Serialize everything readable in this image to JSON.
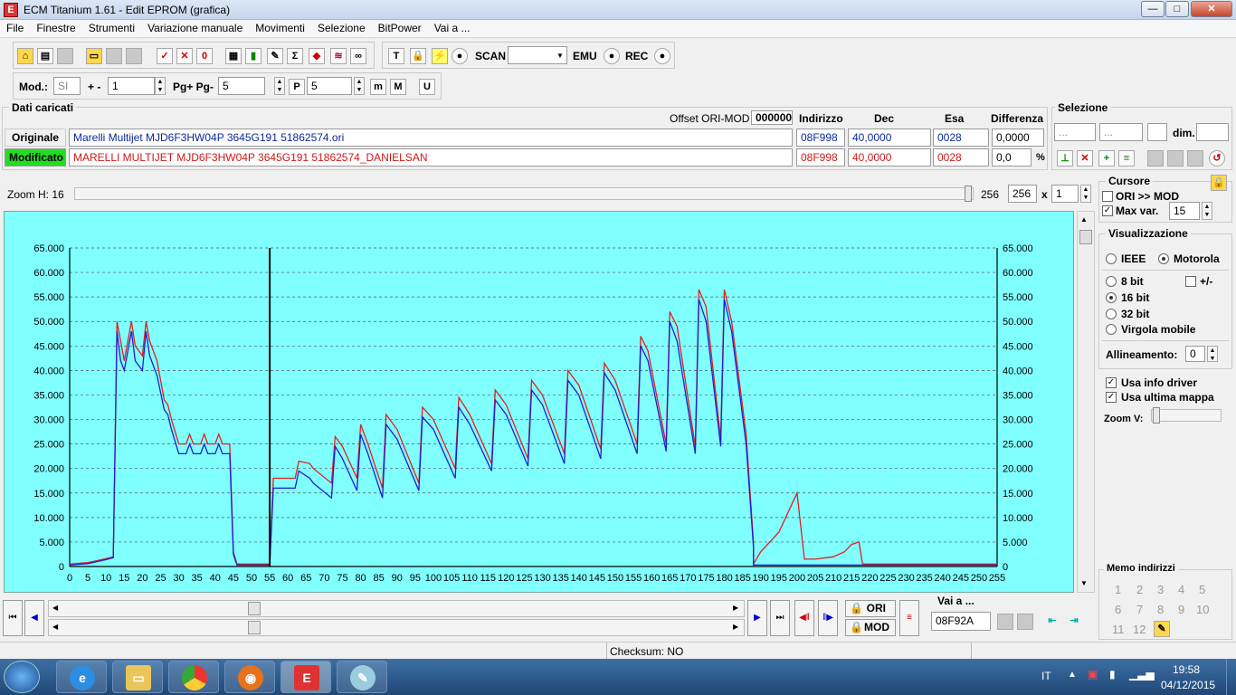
{
  "window": {
    "title": "ECM Titanium 1.61 - Edit EPROM (grafica)",
    "icon": "ecm-app-icon",
    "min": "—",
    "max": "□",
    "close": "✕"
  },
  "menu": [
    "File",
    "Finestre",
    "Strumenti",
    "Variazione manuale",
    "Movimenti",
    "Selezione",
    "BitPower",
    "Vai a ..."
  ],
  "toolbar1": {
    "scan": "SCAN",
    "emu": "EMU",
    "rec": "REC",
    "dropdown": ""
  },
  "toolbar2": {
    "mod_label": "Mod.:",
    "mod_value": "SI",
    "plusminus": "+ -",
    "step": "1",
    "pg_label": "Pg+ Pg-",
    "pg_value": "5",
    "p_value": "5"
  },
  "dati": {
    "title": "Dati caricati",
    "offset_label": "Offset ORI-MOD",
    "offset_value": "000000",
    "col_indirizzo": "Indirizzo",
    "col_dec": "Dec",
    "col_esa": "Esa",
    "col_diff": "Differenza",
    "originale": {
      "label": "Originale",
      "file": "Marelli Multijet MJD6F3HW04P 3645G191 51862574.ori",
      "addr": "08F998",
      "dec": "40,0000",
      "esa": "0028",
      "diff": "0,0000"
    },
    "modificato": {
      "label": "Modificato",
      "file": "MARELLI MULTIJET MJD6F3HW04P 3645G191 51862574_DANIELSAN",
      "addr": "08F998",
      "dec": "40,0000",
      "esa": "0028",
      "diff": "0,0",
      "pct": "%"
    }
  },
  "selezione": {
    "title": "Selezione",
    "f1": "...",
    "f2": "...",
    "dim_label": "dim.",
    "dim_value": ""
  },
  "zoom": {
    "label": "Zoom H: 16",
    "value1": "256",
    "value2": "256",
    "x": "x",
    "mult": "1"
  },
  "cursore": {
    "title": "Cursore",
    "ori_mod": "ORI >> MOD",
    "maxvar_label": "Max var.",
    "maxvar": "15"
  },
  "visual": {
    "title": "Visualizzazione",
    "ieee": "IEEE",
    "motorola": "Motorola",
    "bit8": "8 bit",
    "pm": "+/-",
    "bit16": "16 bit",
    "bit32": "32 bit",
    "virgola": "Virgola mobile",
    "allineamento": "Allineamento:",
    "allin_value": "0",
    "usa_info": "Usa info driver",
    "usa_ultima": "Usa ultima mappa",
    "zoomv": "Zoom V:"
  },
  "memo": {
    "title": "Memo indirizzi",
    "nums": [
      "1",
      "2",
      "3",
      "4",
      "5",
      "6",
      "7",
      "8",
      "9",
      "10",
      "11",
      "12"
    ]
  },
  "nav": {
    "ori": "ORI",
    "mod": "MOD",
    "vai_label": "Vai a ...",
    "vai_value": "08F92A"
  },
  "status": {
    "checksum": "Checksum: NO"
  },
  "tray": {
    "lang": "IT",
    "time": "19:58",
    "date": "04/12/2015"
  },
  "colors": {
    "chart_bg": "#80ffff",
    "ori_line": "#1f1fd0",
    "mod_line": "#e02020",
    "modificato_bg": "#22dd22"
  },
  "chart_data": {
    "type": "line",
    "xlim": [
      0,
      255
    ],
    "ylim": [
      0,
      65000
    ],
    "xticks": [
      "0",
      "5",
      "10",
      "15",
      "20",
      "25",
      "30",
      "35",
      "40",
      "45",
      "50",
      "55",
      "60",
      "65",
      "70",
      "75",
      "80",
      "85",
      "90",
      "95",
      "100",
      "105",
      "110",
      "115",
      "120",
      "125",
      "130",
      "135",
      "140",
      "145",
      "150",
      "155",
      "160",
      "165",
      "170",
      "175",
      "180",
      "185",
      "190",
      "195",
      "200",
      "205",
      "210",
      "215",
      "220",
      "225",
      "230",
      "235",
      "240",
      "245",
      "250",
      "255"
    ],
    "yticks": [
      "0",
      "5.000",
      "10.000",
      "15.000",
      "20.000",
      "25.000",
      "30.000",
      "35.000",
      "40.000",
      "45.000",
      "50.000",
      "55.000",
      "60.000",
      "65.000"
    ],
    "cursor_x": 55,
    "series": [
      {
        "color": "#e02020",
        "points": [
          [
            0,
            500
          ],
          [
            5,
            800
          ],
          [
            10,
            1600
          ],
          [
            12,
            2000
          ],
          [
            13,
            50000
          ],
          [
            14,
            46000
          ],
          [
            15,
            42000
          ],
          [
            17,
            50000
          ],
          [
            18,
            45000
          ],
          [
            20,
            43000
          ],
          [
            21,
            50000
          ],
          [
            22,
            46000
          ],
          [
            24,
            42000
          ],
          [
            26,
            34000
          ],
          [
            27,
            33000
          ],
          [
            28,
            30000
          ],
          [
            30,
            25000
          ],
          [
            32,
            25000
          ],
          [
            33,
            27000
          ],
          [
            34,
            25000
          ],
          [
            36,
            25000
          ],
          [
            37,
            27000
          ],
          [
            38,
            25000
          ],
          [
            40,
            25000
          ],
          [
            41,
            27000
          ],
          [
            42,
            25000
          ],
          [
            44,
            25000
          ],
          [
            45,
            3000
          ],
          [
            46,
            500
          ],
          [
            55,
            500
          ],
          [
            56,
            18000
          ],
          [
            62,
            18000
          ],
          [
            63,
            21500
          ],
          [
            66,
            21000
          ],
          [
            67,
            20000
          ],
          [
            72,
            17000
          ],
          [
            73,
            26500
          ],
          [
            75,
            24500
          ],
          [
            79,
            18000
          ],
          [
            80,
            29000
          ],
          [
            82,
            25000
          ],
          [
            86,
            16000
          ],
          [
            87,
            31000
          ],
          [
            90,
            28000
          ],
          [
            96,
            17000
          ],
          [
            97,
            32500
          ],
          [
            100,
            30000
          ],
          [
            106,
            20000
          ],
          [
            107,
            34500
          ],
          [
            110,
            31000
          ],
          [
            116,
            21000
          ],
          [
            117,
            36000
          ],
          [
            120,
            33000
          ],
          [
            126,
            22000
          ],
          [
            127,
            38000
          ],
          [
            130,
            35000
          ],
          [
            136,
            23000
          ],
          [
            137,
            40000
          ],
          [
            140,
            37000
          ],
          [
            146,
            24000
          ],
          [
            147,
            41500
          ],
          [
            150,
            38000
          ],
          [
            156,
            25000
          ],
          [
            157,
            47000
          ],
          [
            159,
            44000
          ],
          [
            164,
            25000
          ],
          [
            165,
            52000
          ],
          [
            167,
            49000
          ],
          [
            172,
            24500
          ],
          [
            173,
            56500
          ],
          [
            175,
            53000
          ],
          [
            179,
            26000
          ],
          [
            180,
            56500
          ],
          [
            182,
            50000
          ],
          [
            186,
            27000
          ],
          [
            188,
            5000
          ],
          [
            188,
            500
          ],
          [
            190,
            3000
          ],
          [
            195,
            7000
          ],
          [
            200,
            15000
          ],
          [
            202,
            1500
          ],
          [
            205,
            1500
          ],
          [
            210,
            2000
          ],
          [
            213,
            3000
          ],
          [
            215,
            4500
          ],
          [
            217,
            5000
          ],
          [
            218,
            500
          ],
          [
            255,
            500
          ]
        ]
      },
      {
        "color": "#1f1fd0",
        "points": [
          [
            0,
            300
          ],
          [
            5,
            600
          ],
          [
            10,
            1400
          ],
          [
            12,
            1800
          ],
          [
            13,
            48000
          ],
          [
            14,
            42000
          ],
          [
            15,
            40000
          ],
          [
            17,
            48000
          ],
          [
            18,
            42000
          ],
          [
            20,
            40000
          ],
          [
            21,
            48000
          ],
          [
            22,
            43000
          ],
          [
            24,
            39000
          ],
          [
            26,
            32000
          ],
          [
            27,
            31000
          ],
          [
            28,
            28000
          ],
          [
            30,
            23000
          ],
          [
            32,
            23000
          ],
          [
            33,
            25000
          ],
          [
            34,
            23000
          ],
          [
            36,
            23000
          ],
          [
            37,
            25000
          ],
          [
            38,
            23000
          ],
          [
            40,
            23000
          ],
          [
            41,
            25000
          ],
          [
            42,
            23000
          ],
          [
            44,
            23000
          ],
          [
            45,
            2500
          ],
          [
            46,
            300
          ],
          [
            55,
            300
          ],
          [
            56,
            16000
          ],
          [
            62,
            16000
          ],
          [
            63,
            19500
          ],
          [
            66,
            18000
          ],
          [
            67,
            17000
          ],
          [
            72,
            14000
          ],
          [
            73,
            24500
          ],
          [
            75,
            22000
          ],
          [
            79,
            15500
          ],
          [
            80,
            27000
          ],
          [
            82,
            23000
          ],
          [
            86,
            14000
          ],
          [
            87,
            29000
          ],
          [
            90,
            26000
          ],
          [
            96,
            15500
          ],
          [
            97,
            30500
          ],
          [
            100,
            28000
          ],
          [
            106,
            18000
          ],
          [
            107,
            32500
          ],
          [
            110,
            29000
          ],
          [
            116,
            19500
          ],
          [
            117,
            34000
          ],
          [
            120,
            31000
          ],
          [
            126,
            20500
          ],
          [
            127,
            36000
          ],
          [
            130,
            33000
          ],
          [
            136,
            21000
          ],
          [
            137,
            38000
          ],
          [
            140,
            35000
          ],
          [
            146,
            22000
          ],
          [
            147,
            39500
          ],
          [
            150,
            36000
          ],
          [
            156,
            23000
          ],
          [
            157,
            45000
          ],
          [
            159,
            42000
          ],
          [
            164,
            23500
          ],
          [
            165,
            50000
          ],
          [
            167,
            46000
          ],
          [
            172,
            23000
          ],
          [
            173,
            54500
          ],
          [
            175,
            50000
          ],
          [
            179,
            24500
          ],
          [
            180,
            54500
          ],
          [
            182,
            48000
          ],
          [
            186,
            25000
          ],
          [
            188,
            4000
          ],
          [
            188,
            300
          ],
          [
            255,
            300
          ]
        ]
      }
    ]
  }
}
